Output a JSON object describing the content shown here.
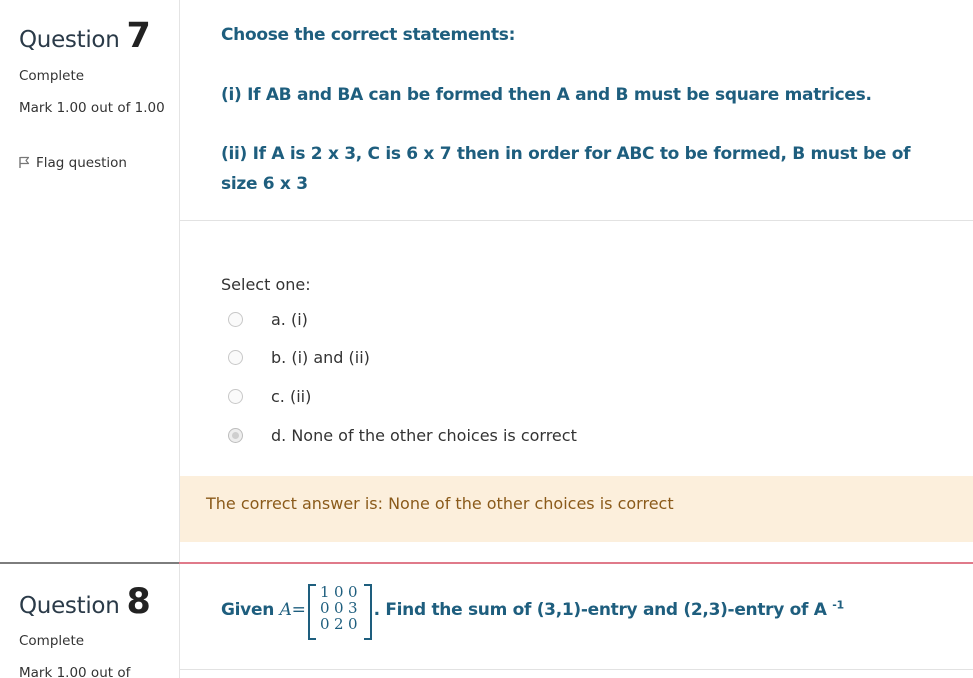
{
  "q7": {
    "label": "Question",
    "number": "7",
    "state": "Complete",
    "grade": "Mark 1.00 out of 1.00",
    "flag": "Flag question",
    "question": "Choose the correct statements:",
    "statement1": "(i) If AB and BA can be formed then A and B must be square matrices.",
    "statement2": "(ii) If A is 2 x 3, C is 6 x 7 then in order for ABC to be formed, B must be of size 6 x 3",
    "prompt": "Select one:",
    "options": [
      {
        "label": "a. (i)",
        "selected": false
      },
      {
        "label": "b. (i) and (ii)",
        "selected": false
      },
      {
        "label": "c. (ii)",
        "selected": false
      },
      {
        "label": "d. None of the other choices is correct",
        "selected": true
      }
    ],
    "feedback": "The correct answer is: None of the other choices is correct"
  },
  "q8": {
    "label": "Question",
    "number": "8",
    "state": "Complete",
    "grade": "Mark 1.00 out of",
    "text_given": "Given",
    "math_var": "A",
    "math_eq": "=",
    "matrix": [
      [
        "1",
        "0",
        "0"
      ],
      [
        "0",
        "0",
        "3"
      ],
      [
        "0",
        "2",
        "0"
      ]
    ],
    "text_after": ". Find the sum of (3,1)-entry and (2,3)-entry of A",
    "superscript": "-1"
  },
  "colors": {
    "question_text": "#1e5e7e",
    "feedback_bg": "#fcefdc",
    "feedback_text": "#8a5a1a",
    "divider_accent": "#e07a8a"
  }
}
